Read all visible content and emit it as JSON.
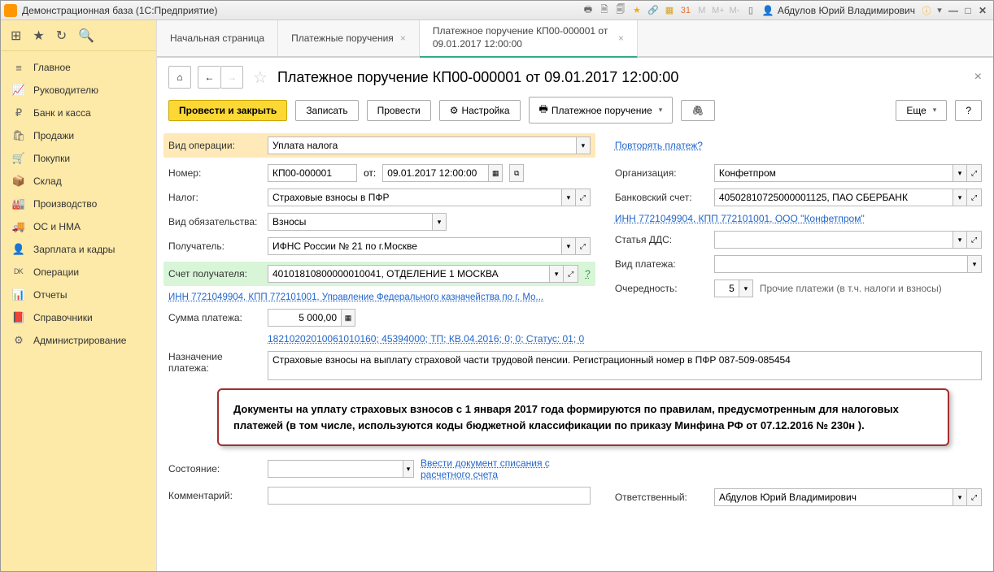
{
  "window": {
    "title": "Демонстрационная база  (1С:Предприятие)",
    "user": "Абдулов Юрий Владимирович"
  },
  "nav": {
    "items": [
      {
        "icon": "≡",
        "label": "Главное"
      },
      {
        "icon": "📈",
        "label": "Руководителю"
      },
      {
        "icon": "₽",
        "label": "Банк и касса"
      },
      {
        "icon": "🛍",
        "label": "Продажи"
      },
      {
        "icon": "🛒",
        "label": "Покупки"
      },
      {
        "icon": "📦",
        "label": "Склад"
      },
      {
        "icon": "🏭",
        "label": "Производство"
      },
      {
        "icon": "🚚",
        "label": "ОС и НМА"
      },
      {
        "icon": "👤",
        "label": "Зарплата и кадры"
      },
      {
        "icon": "ᴰᴷ",
        "label": "Операции"
      },
      {
        "icon": "📊",
        "label": "Отчеты"
      },
      {
        "icon": "📕",
        "label": "Справочники"
      },
      {
        "icon": "⚙",
        "label": "Администрирование"
      }
    ]
  },
  "tabs": [
    {
      "label": "Начальная страница"
    },
    {
      "label": "Платежные поручения",
      "closable": true
    },
    {
      "label": "Платежное поручение КП00-000001 от 09.01.2017 12:00:00",
      "closable": true,
      "active": true
    }
  ],
  "doc": {
    "title": "Платежное поручение КП00-000001 от 09.01.2017 12:00:00",
    "btn_post_close": "Провести и закрыть",
    "btn_save": "Записать",
    "btn_post": "Провести",
    "btn_settings": "Настройка",
    "btn_print": "Платежное поручение",
    "btn_more": "Еще",
    "btn_help": "?",
    "fields": {
      "op_type_lbl": "Вид операции:",
      "op_type": "Уплата налога",
      "repeat_link": "Повторять платеж?",
      "number_lbl": "Номер:",
      "number": "КП00-000001",
      "date_lbl": "от:",
      "date": "09.01.2017 12:00:00",
      "org_lbl": "Организация:",
      "org": "Конфетпром",
      "tax_lbl": "Налог:",
      "tax": "Страховые взносы в ПФР",
      "bank_lbl": "Банковский счет:",
      "bank": "40502810725000001125, ПАО СБЕРБАНК",
      "oblig_lbl": "Вид обязательства:",
      "oblig": "Взносы",
      "inn_link1": "ИНН 7721049904, КПП 772101001, ООО \"Конфетпром\"",
      "recipient_lbl": "Получатель:",
      "recipient": "ИФНС России № 21 по г.Москве",
      "dds_lbl": "Статья ДДС:",
      "dds": "",
      "acct_lbl": "Счет получателя:",
      "acct": "40101810800000010041, ОТДЕЛЕНИЕ 1 МОСКВА",
      "paytype_lbl": "Вид платежа:",
      "paytype": "",
      "inn_link2": "ИНН 7721049904, КПП 772101001, Управление Федерального казначейства по г. Мо...",
      "priority_lbl": "Очередность:",
      "priority": "5",
      "priority_txt": "Прочие платежи (в т.ч. налоги и взносы)",
      "amount_lbl": "Сумма платежа:",
      "amount": "5 000,00",
      "kbk_link": "18210202010061010160; 45394000; ТП; КВ.04.2016; 0; 0; Статус: 01; 0",
      "purpose_lbl": "Назначение платежа:",
      "purpose": "Страховые взносы на выплату страховой части трудовой пенсии. Регистрационный номер в ПФР 087-509-085454",
      "state_lbl": "Состояние:",
      "state": "",
      "enter_doc_link": "Ввести документ списания с расчетного счета",
      "comment_lbl": "Комментарий:",
      "comment": "",
      "resp_lbl": "Ответственный:",
      "resp": "Абдулов Юрий Владимирович"
    },
    "callout": "Документы на уплату страховых взносов с 1 января 2017 года формируются по правилам, предусмотренным для налоговых платежей (в том числе, используются коды бюджетной классификации по приказу Минфина РФ от 07.12.2016 № 230н )."
  }
}
